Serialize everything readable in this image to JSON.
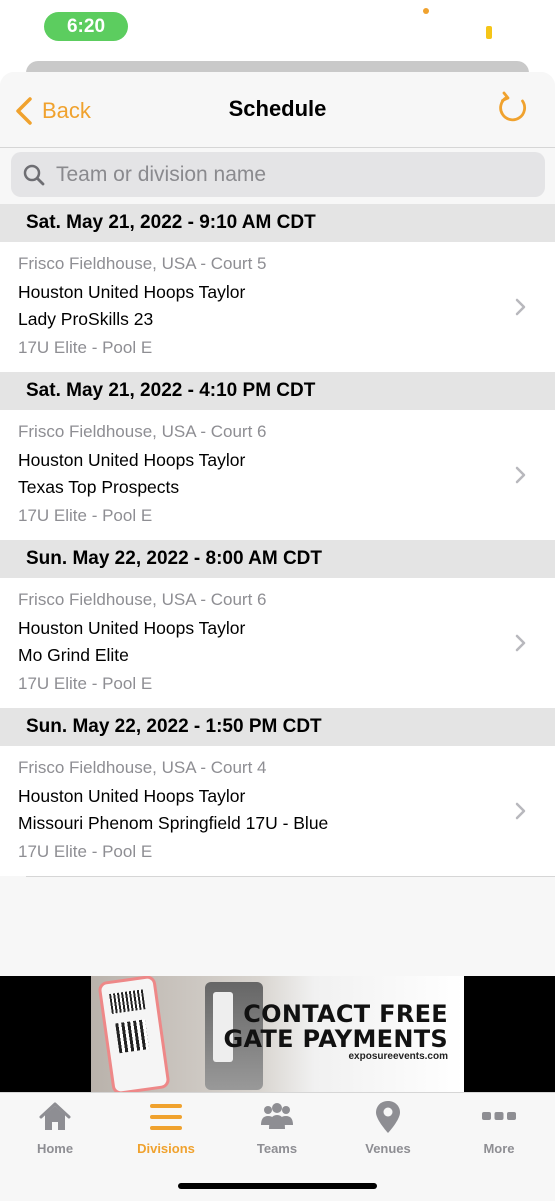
{
  "status_bar": {
    "time": "6:20"
  },
  "nav": {
    "back_label": "Back",
    "title": "Schedule"
  },
  "search": {
    "placeholder": "Team or division name"
  },
  "schedule": [
    {
      "header": "Sat. May 21, 2022 - 9:10 AM CDT",
      "venue": "Frisco Fieldhouse, USA - Court 5",
      "team1": "Houston United Hoops Taylor",
      "team2": "Lady ProSkills 23",
      "division": "17U Elite - Pool E"
    },
    {
      "header": "Sat. May 21, 2022 - 4:10 PM CDT",
      "venue": "Frisco Fieldhouse, USA - Court 6",
      "team1": "Houston United Hoops Taylor",
      "team2": "Texas Top Prospects",
      "division": "17U Elite - Pool E"
    },
    {
      "header": "Sun. May 22, 2022 - 8:00 AM CDT",
      "venue": "Frisco Fieldhouse, USA - Court 6",
      "team1": "Houston United Hoops Taylor",
      "team2": "Mo Grind Elite",
      "division": "17U Elite - Pool E"
    },
    {
      "header": "Sun. May 22, 2022 - 1:50 PM CDT",
      "venue": "Frisco Fieldhouse, USA - Court 4",
      "team1": "Houston United Hoops Taylor",
      "team2": "Missouri Phenom Springfield 17U - Blue",
      "division": "17U Elite - Pool E"
    }
  ],
  "ad": {
    "headline_line1": "CONTACT FREE",
    "headline_line2": "GATE PAYMENTS",
    "url": "exposureevents.com"
  },
  "tabs": [
    {
      "label": "Home",
      "icon": "house-icon",
      "active": false
    },
    {
      "label": "Divisions",
      "icon": "list-icon",
      "active": true
    },
    {
      "label": "Teams",
      "icon": "people-icon",
      "active": false
    },
    {
      "label": "Venues",
      "icon": "map-pin-icon",
      "active": false
    },
    {
      "label": "More",
      "icon": "ellipsis-icon",
      "active": false
    }
  ],
  "colors": {
    "accent": "#f0a22e",
    "status_green": "#5ccd5f",
    "section_bg": "#e4e4e4",
    "secondary_text": "#8e8e93"
  }
}
